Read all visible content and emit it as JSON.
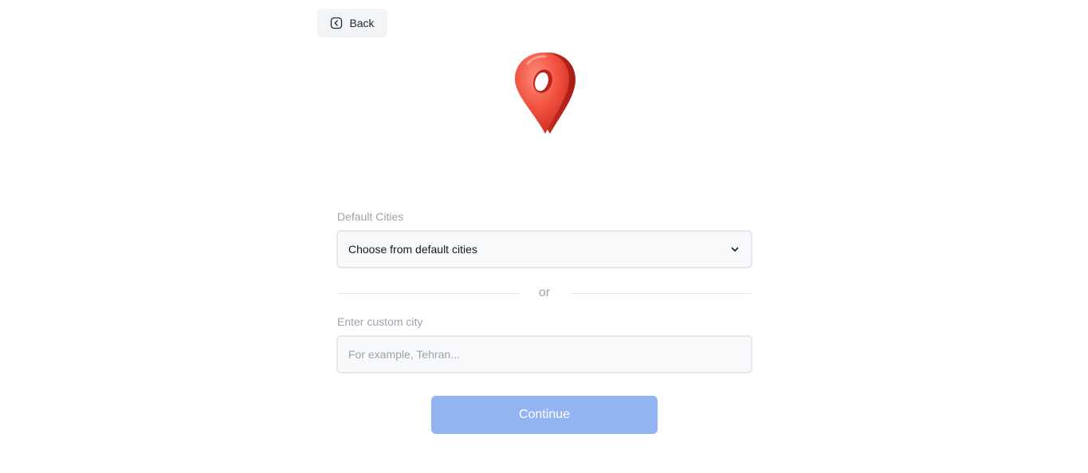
{
  "back": {
    "label": "Back",
    "icon": "chevron-left-icon"
  },
  "hero": {
    "icon": "location-pin-icon",
    "colors": {
      "pin": "#ef4444",
      "pin_dark": "#b91c1c"
    }
  },
  "default_cities": {
    "label": "Default Cities",
    "selected": "Choose from default cities",
    "icon": "chevron-down-icon"
  },
  "separator": {
    "text": "or"
  },
  "custom_city": {
    "label": "Enter custom city",
    "value": "",
    "placeholder": "For example, Tehran..."
  },
  "continue": {
    "label": "Continue",
    "disabled": true,
    "color": "#93b4f3"
  }
}
